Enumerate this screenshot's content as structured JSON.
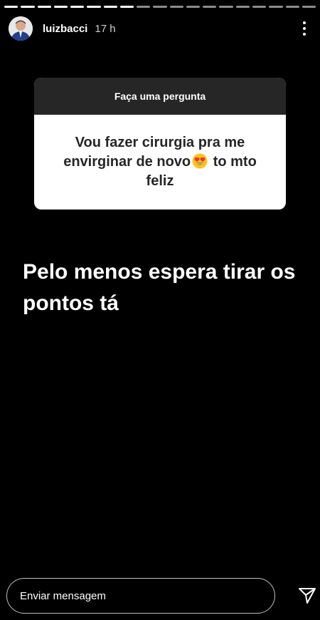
{
  "story": {
    "segments_total": 19,
    "current_segment": 8
  },
  "header": {
    "username": "luizbacci",
    "time": "17 h",
    "more_icon": "more-vertical-icon"
  },
  "question_box": {
    "title": "Faça uma pergunta",
    "question_part1": "Vou fazer cirurgia pra me envirginar de novo",
    "emoji": "heart-eyes-emoji",
    "question_part2": " to mto feliz"
  },
  "answer": {
    "text": "Pelo menos espera tirar os pontos tá"
  },
  "footer": {
    "message_placeholder": "Enviar mensagem",
    "send_icon": "send-icon"
  },
  "colors": {
    "background": "#000000",
    "question_header": "#262626",
    "question_body": "#ffffff"
  }
}
